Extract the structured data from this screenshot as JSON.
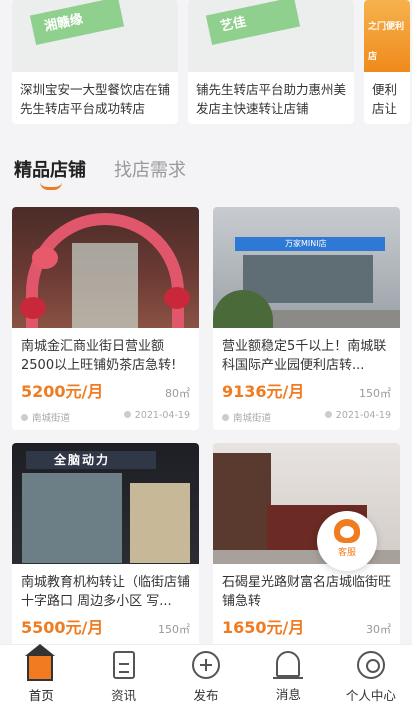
{
  "stories": [
    {
      "tag": "湘赣缘",
      "text": "深圳宝安一大型餐饮店在铺先生转店平台成功转店"
    },
    {
      "tag": "艺佳",
      "text": "铺先生转店平台助力惠州美发店主快速转让店铺"
    },
    {
      "tag": "之门便利店",
      "text": "便利店让"
    }
  ],
  "tabs": [
    {
      "label": "精品店铺",
      "active": true
    },
    {
      "label": "找店需求",
      "active": false
    }
  ],
  "listings": [
    {
      "title": "南城金汇商业街日营业额2500以上旺铺奶茶店急转!",
      "price": "5200元/月",
      "area": "80㎡",
      "location": "南城街道",
      "date": "2021-04-19"
    },
    {
      "title": "营业额稳定5千以上！南城联科国际产业园便利店转...",
      "price": "9136元/月",
      "area": "150㎡",
      "location": "南城街道",
      "date": "2021-04-19"
    },
    {
      "title": "南城教育机构转让（临街店铺 十字路口 周边多小区 写...",
      "price": "5500元/月",
      "area": "150㎡",
      "location": "",
      "date": ""
    },
    {
      "title": "石碣星光路财富名店城临街旺铺急转",
      "price": "1650元/月",
      "area": "30㎡",
      "location": "",
      "date": ""
    }
  ],
  "img3_sign": "全脑动力",
  "img2_sign": "万家MINI店",
  "kefu_label": "客服",
  "nav": [
    {
      "label": "首页",
      "icon": "home-icon",
      "active": true
    },
    {
      "label": "资讯",
      "icon": "news-icon",
      "active": false
    },
    {
      "label": "发布",
      "icon": "plus-circle-icon",
      "active": false
    },
    {
      "label": "消息",
      "icon": "bell-icon",
      "active": false
    },
    {
      "label": "个人中心",
      "icon": "user-icon",
      "active": false
    }
  ],
  "accent_color": "#f07b20"
}
